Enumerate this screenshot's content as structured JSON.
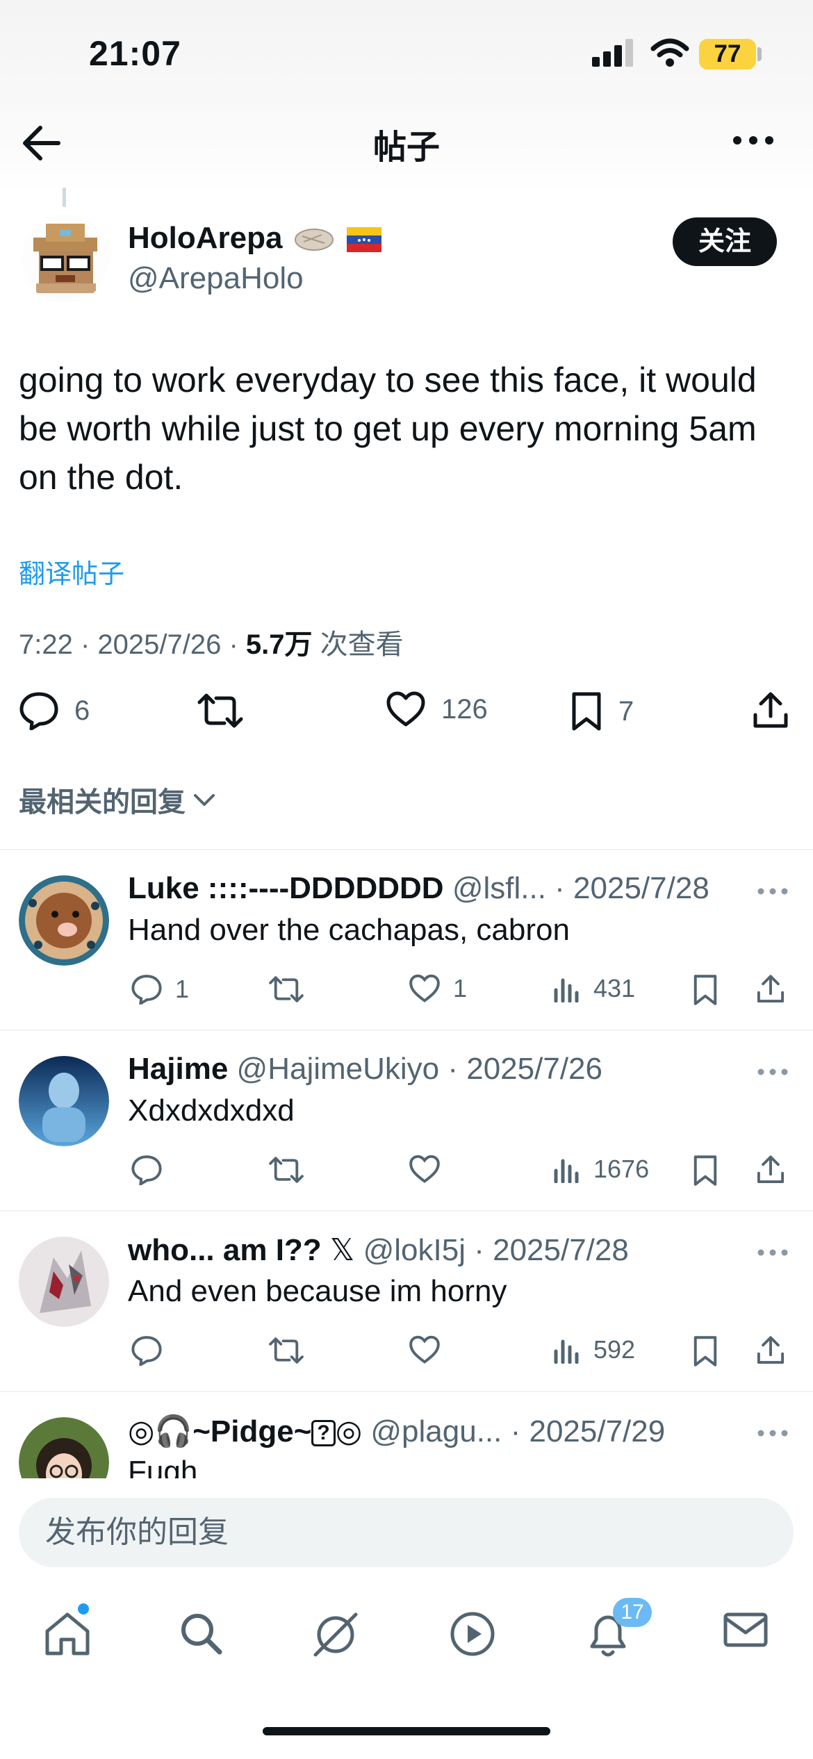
{
  "status_bar": {
    "time": "21:07",
    "battery": "77"
  },
  "nav": {
    "title": "帖子"
  },
  "post": {
    "author_name": "HoloArepa",
    "author_handle": "@ArepaHolo",
    "follow_label": "关注",
    "text": "going to work everyday to see this face, it would be worth while just to get up every morning 5am on the dot.",
    "translate_label": "翻译帖子",
    "meta_time": "7:22 · 2025/7/26 · ",
    "views": "5.7万",
    "views_suffix": " 次查看",
    "replies": "6",
    "likes": "126",
    "bookmarks": "7"
  },
  "sort_label": "最相关的回复",
  "replies": [
    {
      "name": "Luke ::::----DDDDDDD",
      "handle": "@lsfl...",
      "date": " · 2025/7/28",
      "text": "Hand over the cachapas, cabron",
      "reply_count": "1",
      "like_count": "1",
      "views": "431"
    },
    {
      "name": "Hajime",
      "handle": "@HajimeUkiyo",
      "date": " · 2025/7/26",
      "text": "Xdxdxdxdxd",
      "reply_count": "",
      "like_count": "",
      "views": "1676"
    },
    {
      "name": "who... am I??",
      "handle": "@lokI5j",
      "date": " · 2025/7/28",
      "text": "And even because im horny",
      "reply_count": "",
      "like_count": "",
      "views": "592"
    },
    {
      "name": "Pidge",
      "handle": "@plagu...",
      "date": " · 2025/7/29",
      "text": "Fugh"
    }
  ],
  "composer": {
    "placeholder": "发布你的回复"
  },
  "tab_bar": {
    "notifications_badge": "17"
  },
  "colors": {
    "accent": "#1d9bf0",
    "text": "#0f1419",
    "secondary": "#536471",
    "divider": "#eff3f4"
  }
}
